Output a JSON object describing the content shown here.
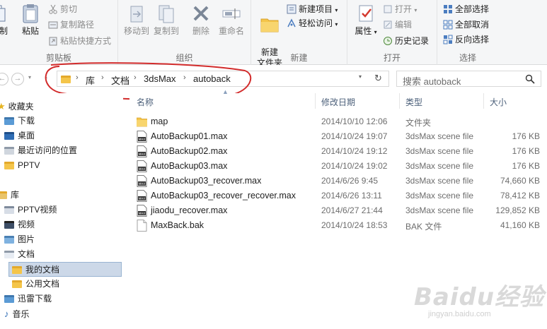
{
  "ribbon": {
    "clipboard": {
      "label": "剪贴板",
      "cut_partial": "制",
      "paste": "粘贴",
      "cut": "剪切",
      "copy_path": "复制路径",
      "paste_shortcut": "粘贴快捷方式"
    },
    "organize": {
      "label": "组织",
      "move_to": "移动到",
      "copy_to": "复制到",
      "delete": "删除",
      "rename": "重命名"
    },
    "new": {
      "label": "新建",
      "new_folder": "新建\n文件夹",
      "new_item": "新建项目",
      "easy_access": "轻松访问"
    },
    "open": {
      "label": "打开",
      "properties": "属性",
      "open": "打开",
      "edit": "编辑",
      "history": "历史记录"
    },
    "select": {
      "label": "选择",
      "select_all": "全部选择",
      "select_none": "全部取消",
      "invert": "反向选择"
    }
  },
  "address": {
    "crumbs": [
      "库",
      "文档",
      "3dsMax",
      "autoback"
    ]
  },
  "search": {
    "placeholder": "搜索 autoback"
  },
  "sidebar": {
    "favorites": "收藏夹",
    "items_fav": [
      "下载",
      "桌面",
      "最近访问的位置",
      "PPTV"
    ],
    "libraries": "库",
    "items_lib": [
      "PPTV视频",
      "视频",
      "图片",
      "文档"
    ],
    "items_docs": [
      "我的文档",
      "公用文档"
    ],
    "items_more": [
      "迅雷下载",
      "音乐"
    ]
  },
  "columns": {
    "name": "名称",
    "date": "修改日期",
    "type": "类型",
    "size": "大小"
  },
  "files": [
    {
      "name": "map",
      "date": "2014/10/10 12:06",
      "type": "文件夹",
      "size": "",
      "kind": "folder"
    },
    {
      "name": "AutoBackup01.max",
      "date": "2014/10/24 19:07",
      "type": "3dsMax scene file",
      "size": "176 KB",
      "kind": "max"
    },
    {
      "name": "AutoBackup02.max",
      "date": "2014/10/24 19:12",
      "type": "3dsMax scene file",
      "size": "176 KB",
      "kind": "max"
    },
    {
      "name": "AutoBackup03.max",
      "date": "2014/10/24 19:02",
      "type": "3dsMax scene file",
      "size": "176 KB",
      "kind": "max"
    },
    {
      "name": "AutoBackup03_recover.max",
      "date": "2014/6/26 9:45",
      "type": "3dsMax scene file",
      "size": "74,660 KB",
      "kind": "max"
    },
    {
      "name": "AutoBackup03_recover_recover.max",
      "date": "2014/6/26 13:11",
      "type": "3dsMax scene file",
      "size": "78,412 KB",
      "kind": "max"
    },
    {
      "name": "jiaodu_recover.max",
      "date": "2014/6/27 21:44",
      "type": "3dsMax scene file",
      "size": "129,852 KB",
      "kind": "max"
    },
    {
      "name": "MaxBack.bak",
      "date": "2014/10/24 18:53",
      "type": "BAK 文件",
      "size": "41,160 KB",
      "kind": "bak"
    }
  ],
  "watermark": {
    "logo": "Baidu经验",
    "url": "jingyan.baidu.com"
  }
}
